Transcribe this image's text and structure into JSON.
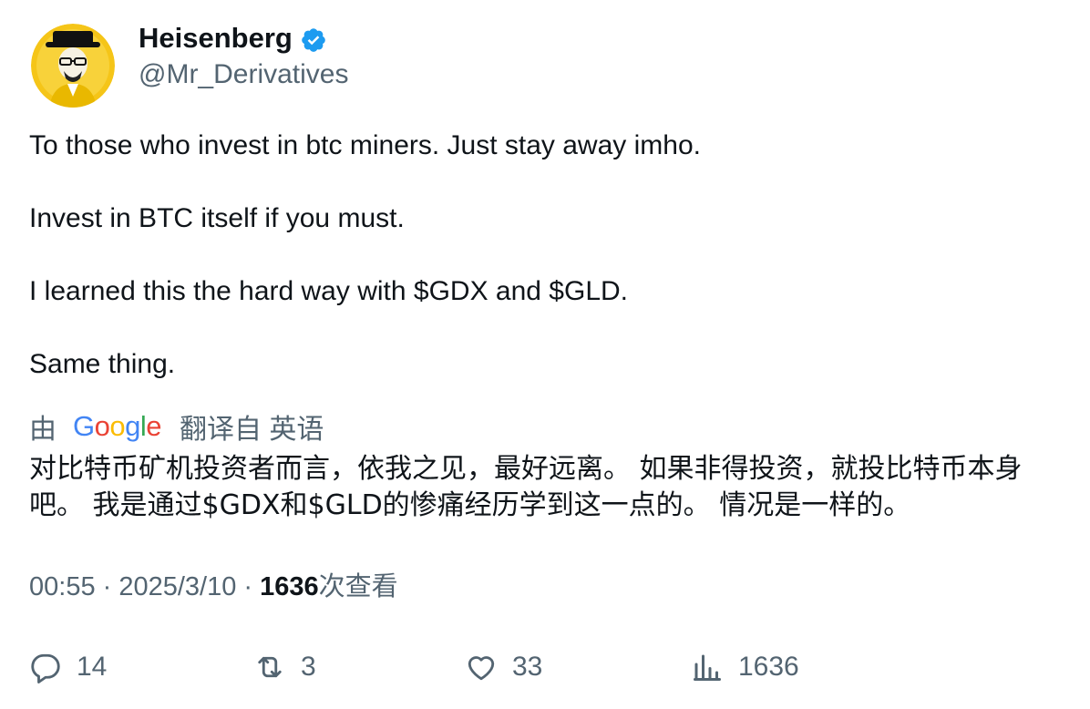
{
  "author": {
    "display_name": "Heisenberg",
    "handle": "@Mr_Derivatives",
    "verified_icon": "verified-badge-icon",
    "badge_color": "#1d9bf0"
  },
  "tweet": {
    "paragraphs": [
      "To those who invest in btc miners. Just stay away imho.",
      "Invest in BTC itself if you must.",
      "I learned this the hard way with $GDX and $GLD.",
      "Same thing."
    ]
  },
  "translation": {
    "prefix": "由",
    "provider_letters": [
      "G",
      "o",
      "o",
      "g",
      "l",
      "e"
    ],
    "suffix": "翻译自 英语",
    "text": "对比特币矿机投资者而言，依我之见，最好远离。 如果非得投资，就投比特币本身吧。 我是通过$GDX和$GLD的惨痛经历学到这一点的。 情况是一样的。"
  },
  "meta": {
    "time": "00:55",
    "sep1": " · ",
    "date": "2025/3/10",
    "sep2": " · ",
    "views_count": "1636",
    "views_label": "次查看"
  },
  "actions": {
    "replies": "14",
    "reposts": "3",
    "likes": "33",
    "views": "1636"
  },
  "colors": {
    "text": "#0f1419",
    "secondary": "#536471",
    "avatar_bg": "#f5c518"
  }
}
